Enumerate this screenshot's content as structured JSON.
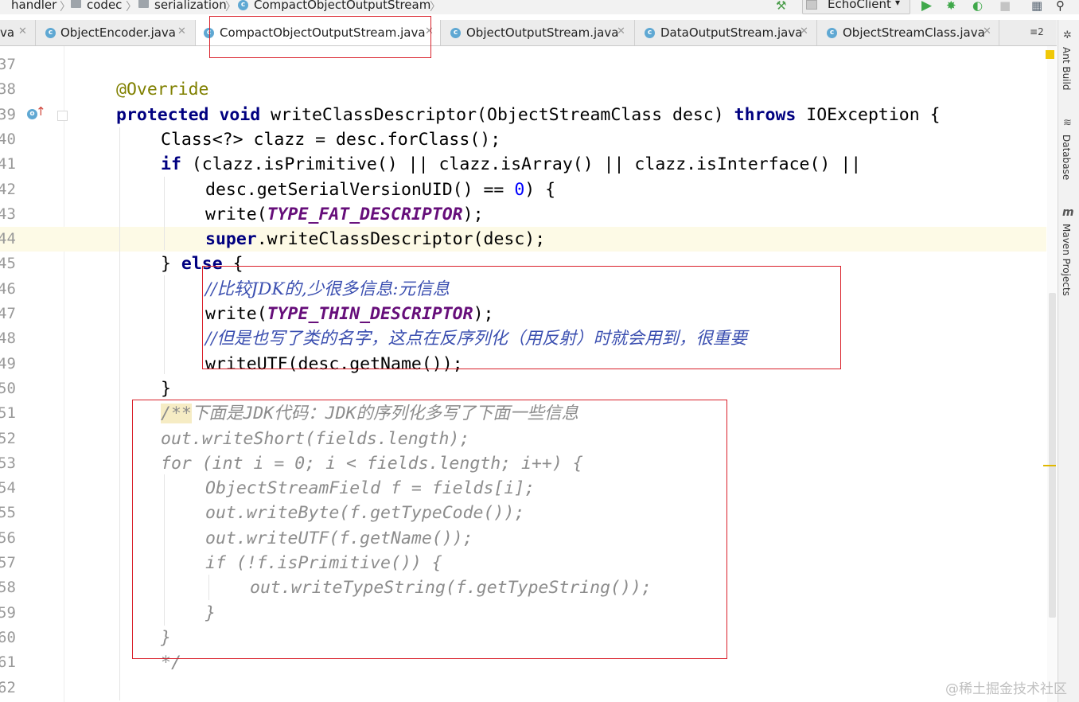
{
  "breadcrumb": {
    "items": [
      "handler",
      "codec",
      "serialization",
      "CompactObjectOutputStream"
    ]
  },
  "toolbar": {
    "run_config": "EchoClient",
    "icons": [
      "build-hammer-icon",
      "run-icon",
      "debug-icon",
      "coverage-icon",
      "stop-icon",
      "project-structure-icon",
      "search-icon"
    ]
  },
  "tabs": {
    "items": [
      {
        "label": "va",
        "active": false
      },
      {
        "label": "ObjectEncoder.java",
        "active": false
      },
      {
        "label": "CompactObjectOutputStream.java",
        "active": true
      },
      {
        "label": "ObjectOutputStream.java",
        "active": false
      },
      {
        "label": "DataOutputStream.java",
        "active": false
      },
      {
        "label": "ObjectStreamClass.java",
        "active": false
      }
    ],
    "overflow": "≡",
    "overflow_count": "2"
  },
  "side_tools": [
    "Ant Build",
    "Database",
    "Maven Projects"
  ],
  "editor": {
    "current_line": "44",
    "lines": [
      {
        "n": "37"
      },
      {
        "n": "38",
        "parts": [
          [
            "ann",
            "@Override"
          ]
        ]
      },
      {
        "n": "39",
        "parts": [
          [
            "kw",
            "protected"
          ],
          [
            "",
            " "
          ],
          [
            "kw",
            "void"
          ],
          [
            "",
            " writeClassDescriptor(ObjectStreamClass desc) "
          ],
          [
            "kw",
            "throws"
          ],
          [
            "",
            " IOException {"
          ]
        ]
      },
      {
        "n": "40",
        "parts": [
          [
            "",
            "Class<?> clazz = desc.forClass();"
          ]
        ]
      },
      {
        "n": "41",
        "parts": [
          [
            "kw",
            "if"
          ],
          [
            "",
            " (clazz.isPrimitive() || clazz.isArray() || clazz.isInterface() ||"
          ]
        ]
      },
      {
        "n": "42",
        "parts": [
          [
            "",
            "desc.getSerialVersionUID() == "
          ],
          [
            "num",
            "0"
          ],
          [
            "",
            ") {"
          ]
        ]
      },
      {
        "n": "43",
        "parts": [
          [
            "",
            "write("
          ],
          [
            "const",
            "TYPE_FAT_DESCRIPTOR"
          ],
          [
            "",
            ");"
          ]
        ]
      },
      {
        "n": "44",
        "parts": [
          [
            "kw",
            "super"
          ],
          [
            "",
            ".writeClassDescriptor(desc);"
          ]
        ]
      },
      {
        "n": "45",
        "parts": [
          [
            "",
            "} "
          ],
          [
            "kw",
            "else"
          ],
          [
            "",
            " {"
          ]
        ]
      },
      {
        "n": "46",
        "parts": [
          [
            "cmt",
            "//比较JDK的,少很多信息:元信息"
          ]
        ]
      },
      {
        "n": "47",
        "parts": [
          [
            "",
            "write("
          ],
          [
            "const",
            "TYPE_THIN_DESCRIPTOR"
          ],
          [
            "",
            ");"
          ]
        ]
      },
      {
        "n": "48",
        "parts": [
          [
            "cmt",
            "//但是也写了类的名字，这点在反序列化（用反射）时就会用到，很重要"
          ]
        ]
      },
      {
        "n": "49",
        "parts": [
          [
            "",
            "writeUTF(desc.getName());"
          ]
        ]
      },
      {
        "n": "50",
        "parts": [
          [
            "",
            "}"
          ]
        ]
      },
      {
        "n": "51",
        "parts": [
          [
            "doc-hl",
            "/**"
          ],
          [
            "doc",
            "下面是JDK代码：JDK的序列化多写了下面一些信息"
          ]
        ]
      },
      {
        "n": "52",
        "parts": [
          [
            "doc",
            "out.writeShort(fields.length);"
          ]
        ]
      },
      {
        "n": "53",
        "parts": [
          [
            "doc",
            "for (int i = 0; i < fields.length; i++) {"
          ]
        ]
      },
      {
        "n": "54",
        "parts": [
          [
            "doc",
            "ObjectStreamField f = fields[i];"
          ]
        ]
      },
      {
        "n": "55",
        "parts": [
          [
            "doc",
            "out.writeByte(f.getTypeCode());"
          ]
        ]
      },
      {
        "n": "56",
        "parts": [
          [
            "doc",
            "out.writeUTF(f.getName());"
          ]
        ]
      },
      {
        "n": "57",
        "parts": [
          [
            "doc",
            "if (!f.isPrimitive()) {"
          ]
        ]
      },
      {
        "n": "58",
        "parts": [
          [
            "doc",
            "out.writeTypeString(f.getTypeString());"
          ]
        ]
      },
      {
        "n": "59",
        "parts": [
          [
            "doc",
            "}"
          ]
        ]
      },
      {
        "n": "60",
        "parts": [
          [
            "doc",
            "}"
          ]
        ]
      },
      {
        "n": "61",
        "parts": [
          [
            "doc",
            "*/"
          ]
        ]
      },
      {
        "n": "62"
      }
    ]
  },
  "watermark": "@稀土掘金技术社区"
}
